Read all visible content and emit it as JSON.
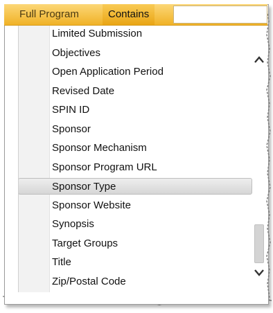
{
  "header": {
    "field_label": "Full Program",
    "operator_label": "Contains",
    "search_value": ""
  },
  "list": {
    "items": [
      {
        "label": "Limited Submission",
        "selected": false
      },
      {
        "label": "Objectives",
        "selected": false
      },
      {
        "label": "Open Application Period",
        "selected": false
      },
      {
        "label": "Revised Date",
        "selected": false
      },
      {
        "label": "SPIN ID",
        "selected": false
      },
      {
        "label": "Sponsor",
        "selected": false
      },
      {
        "label": "Sponsor Mechanism",
        "selected": false
      },
      {
        "label": "Sponsor Program URL",
        "selected": false
      },
      {
        "label": "Sponsor Type",
        "selected": true
      },
      {
        "label": "Sponsor Website",
        "selected": false
      },
      {
        "label": "Synopsis",
        "selected": false
      },
      {
        "label": "Target Groups",
        "selected": false
      },
      {
        "label": "Title",
        "selected": false
      },
      {
        "label": "Zip/Postal Code",
        "selected": false
      }
    ]
  },
  "scrollbar": {
    "up_icon": "chevron-up-icon",
    "down_icon": "chevron-down-icon",
    "thumb_start_fraction": 0.8,
    "thumb_end_fraction": 1.0
  },
  "colors": {
    "header_accent": "#f0b227",
    "selected_row": "#d6d6d6"
  }
}
